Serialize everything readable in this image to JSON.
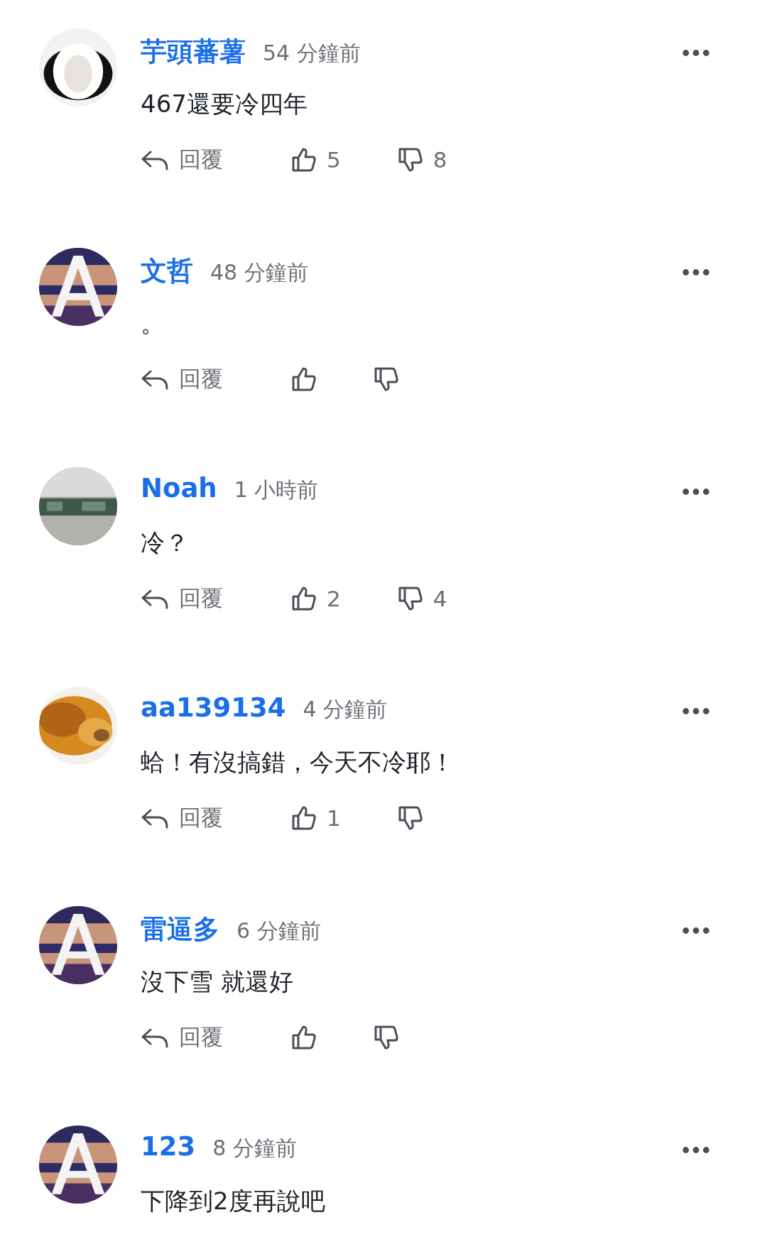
{
  "comments": [
    {
      "name": "芋頭蕃薯",
      "time": "54 分鐘前",
      "text": "467還要冷四年",
      "actions": {
        "reply": "回覆",
        "likes": "5",
        "dislikes": "8"
      }
    },
    {
      "name": "文哲",
      "time": "48 分鐘前",
      "text": "。",
      "actions": {
        "reply": "回覆"
      }
    },
    {
      "name": "Noah",
      "time": "1 小時前",
      "text": "冷？",
      "actions": {
        "reply": "回覆",
        "likes": "2",
        "dislikes": "4"
      }
    },
    {
      "name": "aa139134",
      "time": "4 分鐘前",
      "text": "蛤！有沒搞錯，今天不冷耶！",
      "actions": {
        "reply": "回覆",
        "likes": "1"
      }
    },
    {
      "name": "雷逼多",
      "time": "6 分鐘前",
      "text": "沒下雪 就還好",
      "actions": {
        "reply": "回覆"
      }
    },
    {
      "name": "123",
      "time": "8 分鐘前",
      "text": "下降到2度再說吧"
    }
  ]
}
